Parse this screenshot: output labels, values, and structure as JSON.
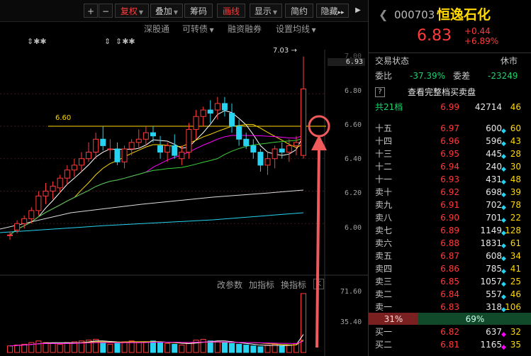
{
  "toolbar": {
    "plus": "+",
    "minus": "−",
    "fuquan": "复权",
    "diejia": "叠加",
    "chouma": "筹码",
    "huaxian": "画线",
    "xianshi": "显示",
    "jianyue": "简约",
    "yincang": "隐藏",
    "more": "▸▸",
    "collapse": "▶"
  },
  "subbar": {
    "shengutong": "深股通",
    "kezhuanzhai": "可转债",
    "rongzi": "融资融券",
    "settings": "设置均线"
  },
  "markers": [
    "⇕✱✱",
    "⇕",
    "⇕✱✱"
  ],
  "indicator_bar": {
    "param": "改参数",
    "add": "加指标",
    "switch": "换指标",
    "close": "K"
  },
  "price_axis": [
    "7.00",
    "6.93",
    "6.80",
    "6.60",
    "6.40",
    "6.20",
    "6.00"
  ],
  "volume_axis": [
    "71.60",
    "35.40"
  ],
  "annotations": {
    "high": "7.03",
    "level": "6.60"
  },
  "chart_data": {
    "type": "candlestick",
    "ylim": [
      5.87,
      7.05
    ],
    "candles": [
      [
        5.93,
        5.95,
        5.9,
        5.93
      ],
      [
        5.96,
        6.02,
        5.94,
        6.0
      ],
      [
        6.0,
        6.05,
        5.97,
        6.03
      ],
      [
        6.03,
        6.1,
        6.0,
        6.08
      ],
      [
        6.08,
        6.2,
        6.05,
        6.17
      ],
      [
        6.17,
        6.25,
        6.12,
        6.2
      ],
      [
        6.2,
        6.26,
        6.15,
        6.23
      ],
      [
        6.22,
        6.3,
        6.19,
        6.28
      ],
      [
        6.28,
        6.36,
        6.24,
        6.33
      ],
      [
        6.33,
        6.4,
        6.29,
        6.36
      ],
      [
        6.36,
        6.44,
        6.32,
        6.4
      ],
      [
        6.4,
        6.5,
        6.38,
        6.44
      ],
      [
        6.44,
        6.56,
        6.4,
        6.52
      ],
      [
        6.52,
        6.6,
        6.45,
        6.48
      ],
      [
        6.46,
        6.52,
        6.4,
        6.46
      ],
      [
        6.46,
        6.5,
        6.36,
        6.38
      ],
      [
        6.38,
        6.48,
        6.34,
        6.46
      ],
      [
        6.46,
        6.52,
        6.42,
        6.5
      ],
      [
        6.5,
        6.58,
        6.46,
        6.52
      ],
      [
        6.52,
        6.6,
        6.48,
        6.56
      ],
      [
        6.56,
        6.6,
        6.5,
        6.54
      ],
      [
        6.48,
        6.54,
        6.4,
        6.44
      ],
      [
        6.44,
        6.5,
        6.38,
        6.48
      ],
      [
        6.48,
        6.55,
        6.4,
        6.42
      ],
      [
        6.4,
        6.48,
        6.36,
        6.44
      ],
      [
        6.44,
        6.62,
        6.4,
        6.58
      ],
      [
        6.58,
        6.7,
        6.52,
        6.66
      ],
      [
        6.66,
        6.72,
        6.6,
        6.7
      ],
      [
        6.7,
        6.76,
        6.62,
        6.68
      ],
      [
        6.7,
        6.78,
        6.64,
        6.74
      ],
      [
        6.74,
        6.78,
        6.66,
        6.7
      ],
      [
        6.68,
        6.74,
        6.56,
        6.6
      ],
      [
        6.6,
        6.64,
        6.48,
        6.52
      ],
      [
        6.52,
        6.56,
        6.46,
        6.48
      ],
      [
        6.48,
        6.52,
        6.4,
        6.44
      ],
      [
        6.44,
        6.46,
        6.32,
        6.36
      ],
      [
        6.36,
        6.44,
        6.3,
        6.4
      ],
      [
        6.4,
        6.48,
        6.34,
        6.46
      ],
      [
        6.46,
        6.5,
        6.4,
        6.44
      ],
      [
        6.44,
        6.52,
        6.38,
        6.48
      ],
      [
        6.48,
        6.54,
        6.42,
        6.5
      ],
      [
        6.42,
        7.03,
        6.4,
        6.83
      ]
    ],
    "volumes": [
      8,
      9,
      10,
      12,
      14,
      12,
      11,
      10,
      12,
      13,
      14,
      15,
      16,
      12,
      10,
      11,
      13,
      14,
      12,
      13,
      14,
      12,
      11,
      10,
      9,
      12,
      15,
      16,
      14,
      13,
      12,
      11,
      10,
      9,
      8,
      7,
      9,
      10,
      8,
      9,
      11,
      71.6
    ]
  },
  "stock": {
    "code": "000703",
    "name": "恒逸石化",
    "price": "6.83",
    "change": "+0.44",
    "pct": "+6.89%"
  },
  "status": {
    "label": "交易状态",
    "value": "休市"
  },
  "weibi": {
    "label": "委比",
    "value": "-37.39%",
    "wc_label": "委差",
    "wc_value": "-23249"
  },
  "full_book": "查看完整档买卖盘",
  "total_levels": "共21档",
  "total_row": {
    "price": "6.99",
    "vol": "42714",
    "num": "46"
  },
  "asks": [
    {
      "label": "十五",
      "price": "6.97",
      "vol": "600",
      "num": "60",
      "dot": "◆",
      "dc": "cyan"
    },
    {
      "label": "十四",
      "price": "6.96",
      "vol": "596",
      "num": "43",
      "dot": "◆",
      "dc": "cyan"
    },
    {
      "label": "十三",
      "price": "6.95",
      "vol": "445",
      "num": "28",
      "dot": "◆",
      "dc": "cyan"
    },
    {
      "label": "十二",
      "price": "6.94",
      "vol": "240",
      "num": "30",
      "dot": "◆",
      "dc": "cyan"
    },
    {
      "label": "十一",
      "price": "6.93",
      "vol": "431",
      "num": "48",
      "dot": "◆",
      "dc": "cyan"
    },
    {
      "label": "卖十",
      "price": "6.92",
      "vol": "698",
      "num": "39",
      "dot": "◆",
      "dc": "cyan"
    },
    {
      "label": "卖九",
      "price": "6.91",
      "vol": "702",
      "num": "78",
      "dot": "◆",
      "dc": "cyan"
    },
    {
      "label": "卖八",
      "price": "6.90",
      "vol": "701",
      "num": "22",
      "dot": "◆",
      "dc": "cyan"
    },
    {
      "label": "卖七",
      "price": "6.89",
      "vol": "1149",
      "num": "128",
      "dot": "◆",
      "dc": "cyan"
    },
    {
      "label": "卖六",
      "price": "6.88",
      "vol": "1831",
      "num": "61",
      "dot": "◆",
      "dc": "cyan"
    },
    {
      "label": "卖五",
      "price": "6.87",
      "vol": "608",
      "num": "34",
      "dot": "◆",
      "dc": "cyan"
    },
    {
      "label": "卖四",
      "price": "6.86",
      "vol": "785",
      "num": "41",
      "dot": "◆",
      "dc": "cyan"
    },
    {
      "label": "卖三",
      "price": "6.85",
      "vol": "1057",
      "num": "25",
      "dot": "◆",
      "dc": "cyan"
    },
    {
      "label": "卖二",
      "price": "6.84",
      "vol": "557",
      "num": "46",
      "dot": "◆",
      "dc": "cyan"
    },
    {
      "label": "卖一",
      "price": "6.83",
      "vol": "318",
      "num": "106",
      "dot": "◆",
      "dc": "cyan"
    }
  ],
  "ratio": {
    "buy": "31%",
    "sell": "69%"
  },
  "bids": [
    {
      "label": "买一",
      "price": "6.82",
      "vol": "637",
      "num": "32",
      "dot": "◆",
      "dc": "mag"
    },
    {
      "label": "买二",
      "price": "6.81",
      "vol": "1165",
      "num": "35",
      "dot": "◆",
      "dc": "mag"
    }
  ]
}
